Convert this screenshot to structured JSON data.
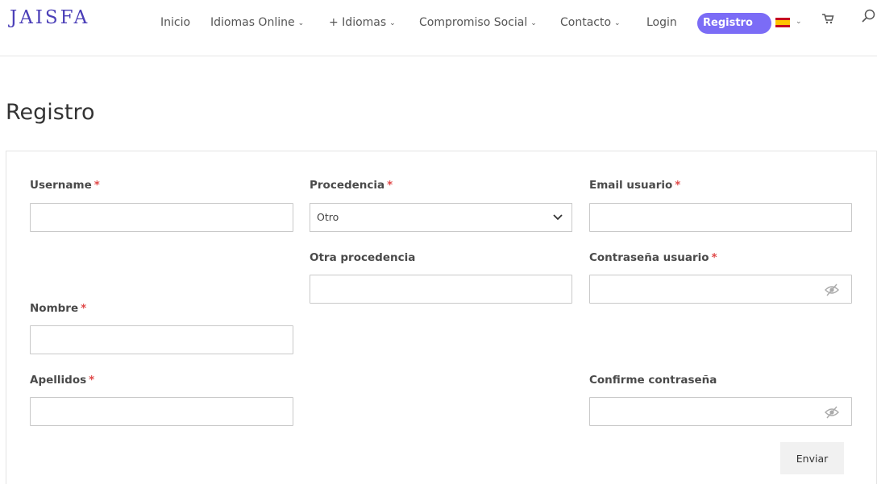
{
  "header": {
    "logo": "JAISFA",
    "nav": [
      {
        "label": "Inicio"
      },
      {
        "label": "Idiomas Online"
      },
      {
        "label": "+ Idiomas"
      },
      {
        "label": "Compromiso Social"
      },
      {
        "label": "Contacto"
      },
      {
        "label": "Login"
      }
    ],
    "registro_label": "Registro",
    "language_flag": "spain-flag-icon"
  },
  "page": {
    "title": "Registro"
  },
  "form": {
    "required_mark": "*",
    "username_label": "Username",
    "procedencia_label": "Procedencia",
    "procedencia_value": "Otro",
    "email_label": "Email usuario",
    "otra_procedencia_label": "Otra procedencia",
    "password_label": "Contraseña usuario",
    "nombre_label": "Nombre",
    "apellidos_label": "Apellidos",
    "confirm_password_label": "Confirme contraseña",
    "submit_label": "Enviar"
  },
  "colors": {
    "brand": "#4b3fb8",
    "pill": "#7b6cf6",
    "required": "#e04848"
  }
}
